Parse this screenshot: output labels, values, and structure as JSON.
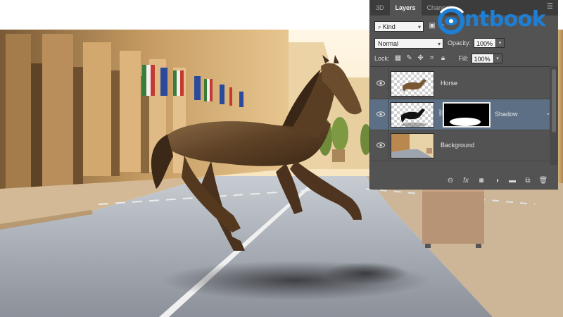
{
  "panel": {
    "tabs": [
      {
        "label": "3D",
        "active": false
      },
      {
        "label": "Layers",
        "active": true
      },
      {
        "label": "Channels",
        "active": false
      }
    ],
    "filter": {
      "label": "Kind"
    },
    "blend_mode": "Normal",
    "opacity": {
      "label": "Opacity:",
      "value": "100%"
    },
    "lock": {
      "label": "Lock:"
    },
    "fill": {
      "label": "Fill:",
      "value": "100%"
    },
    "layers": [
      {
        "name": "Horse",
        "selected": false,
        "has_mask": false
      },
      {
        "name": "Shadow",
        "selected": true,
        "has_mask": true
      },
      {
        "name": "Background",
        "selected": false,
        "has_mask": false
      }
    ],
    "footer_icons": [
      "link-icon",
      "fx-icon",
      "mask-icon",
      "adjustment-icon",
      "folder-icon",
      "new-layer-icon",
      "trash-icon"
    ]
  },
  "logo": {
    "text": "ntbook"
  },
  "colors": {
    "panel_bg": "#535353",
    "selection": "#5c6f85",
    "logo_blue": "#1e7fd6"
  }
}
